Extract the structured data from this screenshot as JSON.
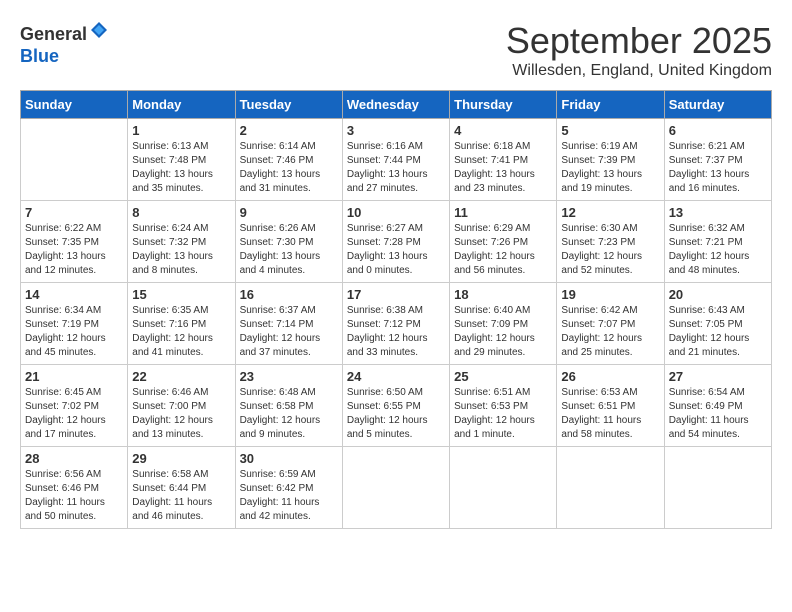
{
  "header": {
    "logo_line1": "General",
    "logo_line2": "Blue",
    "month": "September 2025",
    "location": "Willesden, England, United Kingdom"
  },
  "days_of_week": [
    "Sunday",
    "Monday",
    "Tuesday",
    "Wednesday",
    "Thursday",
    "Friday",
    "Saturday"
  ],
  "weeks": [
    [
      {
        "day": "",
        "sunrise": "",
        "sunset": "",
        "daylight": ""
      },
      {
        "day": "1",
        "sunrise": "Sunrise: 6:13 AM",
        "sunset": "Sunset: 7:48 PM",
        "daylight": "Daylight: 13 hours and 35 minutes."
      },
      {
        "day": "2",
        "sunrise": "Sunrise: 6:14 AM",
        "sunset": "Sunset: 7:46 PM",
        "daylight": "Daylight: 13 hours and 31 minutes."
      },
      {
        "day": "3",
        "sunrise": "Sunrise: 6:16 AM",
        "sunset": "Sunset: 7:44 PM",
        "daylight": "Daylight: 13 hours and 27 minutes."
      },
      {
        "day": "4",
        "sunrise": "Sunrise: 6:18 AM",
        "sunset": "Sunset: 7:41 PM",
        "daylight": "Daylight: 13 hours and 23 minutes."
      },
      {
        "day": "5",
        "sunrise": "Sunrise: 6:19 AM",
        "sunset": "Sunset: 7:39 PM",
        "daylight": "Daylight: 13 hours and 19 minutes."
      },
      {
        "day": "6",
        "sunrise": "Sunrise: 6:21 AM",
        "sunset": "Sunset: 7:37 PM",
        "daylight": "Daylight: 13 hours and 16 minutes."
      }
    ],
    [
      {
        "day": "7",
        "sunrise": "Sunrise: 6:22 AM",
        "sunset": "Sunset: 7:35 PM",
        "daylight": "Daylight: 13 hours and 12 minutes."
      },
      {
        "day": "8",
        "sunrise": "Sunrise: 6:24 AM",
        "sunset": "Sunset: 7:32 PM",
        "daylight": "Daylight: 13 hours and 8 minutes."
      },
      {
        "day": "9",
        "sunrise": "Sunrise: 6:26 AM",
        "sunset": "Sunset: 7:30 PM",
        "daylight": "Daylight: 13 hours and 4 minutes."
      },
      {
        "day": "10",
        "sunrise": "Sunrise: 6:27 AM",
        "sunset": "Sunset: 7:28 PM",
        "daylight": "Daylight: 13 hours and 0 minutes."
      },
      {
        "day": "11",
        "sunrise": "Sunrise: 6:29 AM",
        "sunset": "Sunset: 7:26 PM",
        "daylight": "Daylight: 12 hours and 56 minutes."
      },
      {
        "day": "12",
        "sunrise": "Sunrise: 6:30 AM",
        "sunset": "Sunset: 7:23 PM",
        "daylight": "Daylight: 12 hours and 52 minutes."
      },
      {
        "day": "13",
        "sunrise": "Sunrise: 6:32 AM",
        "sunset": "Sunset: 7:21 PM",
        "daylight": "Daylight: 12 hours and 48 minutes."
      }
    ],
    [
      {
        "day": "14",
        "sunrise": "Sunrise: 6:34 AM",
        "sunset": "Sunset: 7:19 PM",
        "daylight": "Daylight: 12 hours and 45 minutes."
      },
      {
        "day": "15",
        "sunrise": "Sunrise: 6:35 AM",
        "sunset": "Sunset: 7:16 PM",
        "daylight": "Daylight: 12 hours and 41 minutes."
      },
      {
        "day": "16",
        "sunrise": "Sunrise: 6:37 AM",
        "sunset": "Sunset: 7:14 PM",
        "daylight": "Daylight: 12 hours and 37 minutes."
      },
      {
        "day": "17",
        "sunrise": "Sunrise: 6:38 AM",
        "sunset": "Sunset: 7:12 PM",
        "daylight": "Daylight: 12 hours and 33 minutes."
      },
      {
        "day": "18",
        "sunrise": "Sunrise: 6:40 AM",
        "sunset": "Sunset: 7:09 PM",
        "daylight": "Daylight: 12 hours and 29 minutes."
      },
      {
        "day": "19",
        "sunrise": "Sunrise: 6:42 AM",
        "sunset": "Sunset: 7:07 PM",
        "daylight": "Daylight: 12 hours and 25 minutes."
      },
      {
        "day": "20",
        "sunrise": "Sunrise: 6:43 AM",
        "sunset": "Sunset: 7:05 PM",
        "daylight": "Daylight: 12 hours and 21 minutes."
      }
    ],
    [
      {
        "day": "21",
        "sunrise": "Sunrise: 6:45 AM",
        "sunset": "Sunset: 7:02 PM",
        "daylight": "Daylight: 12 hours and 17 minutes."
      },
      {
        "day": "22",
        "sunrise": "Sunrise: 6:46 AM",
        "sunset": "Sunset: 7:00 PM",
        "daylight": "Daylight: 12 hours and 13 minutes."
      },
      {
        "day": "23",
        "sunrise": "Sunrise: 6:48 AM",
        "sunset": "Sunset: 6:58 PM",
        "daylight": "Daylight: 12 hours and 9 minutes."
      },
      {
        "day": "24",
        "sunrise": "Sunrise: 6:50 AM",
        "sunset": "Sunset: 6:55 PM",
        "daylight": "Daylight: 12 hours and 5 minutes."
      },
      {
        "day": "25",
        "sunrise": "Sunrise: 6:51 AM",
        "sunset": "Sunset: 6:53 PM",
        "daylight": "Daylight: 12 hours and 1 minute."
      },
      {
        "day": "26",
        "sunrise": "Sunrise: 6:53 AM",
        "sunset": "Sunset: 6:51 PM",
        "daylight": "Daylight: 11 hours and 58 minutes."
      },
      {
        "day": "27",
        "sunrise": "Sunrise: 6:54 AM",
        "sunset": "Sunset: 6:49 PM",
        "daylight": "Daylight: 11 hours and 54 minutes."
      }
    ],
    [
      {
        "day": "28",
        "sunrise": "Sunrise: 6:56 AM",
        "sunset": "Sunset: 6:46 PM",
        "daylight": "Daylight: 11 hours and 50 minutes."
      },
      {
        "day": "29",
        "sunrise": "Sunrise: 6:58 AM",
        "sunset": "Sunset: 6:44 PM",
        "daylight": "Daylight: 11 hours and 46 minutes."
      },
      {
        "day": "30",
        "sunrise": "Sunrise: 6:59 AM",
        "sunset": "Sunset: 6:42 PM",
        "daylight": "Daylight: 11 hours and 42 minutes."
      },
      {
        "day": "",
        "sunrise": "",
        "sunset": "",
        "daylight": ""
      },
      {
        "day": "",
        "sunrise": "",
        "sunset": "",
        "daylight": ""
      },
      {
        "day": "",
        "sunrise": "",
        "sunset": "",
        "daylight": ""
      },
      {
        "day": "",
        "sunrise": "",
        "sunset": "",
        "daylight": ""
      }
    ]
  ]
}
